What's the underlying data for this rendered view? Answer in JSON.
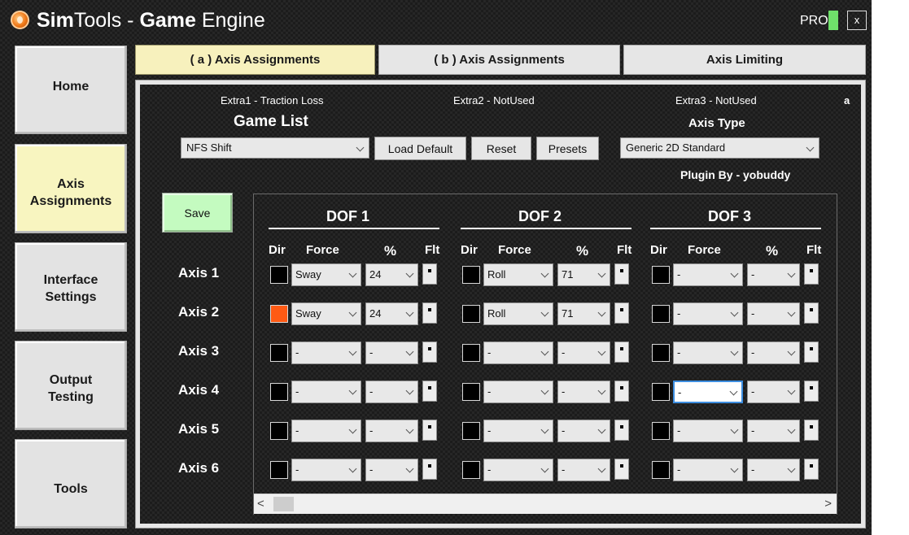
{
  "title": {
    "bold1": "Sim",
    "plain1": "Tools - ",
    "bold2": "Game",
    "plain2": " Engine"
  },
  "pro_label": "PRO",
  "close_glyph": "x",
  "nav": [
    {
      "line1": "Home",
      "line2": ""
    },
    {
      "line1": "Axis",
      "line2": "Assignments"
    },
    {
      "line1": "Interface",
      "line2": "Settings"
    },
    {
      "line1": "Output",
      "line2": "Testing"
    },
    {
      "line1": "Tools",
      "line2": ""
    }
  ],
  "tabs": [
    "( a ) Axis Assignments",
    "( b ) Axis Assignments",
    "Axis Limiting"
  ],
  "extras": [
    "Extra1 - Traction Loss",
    "Extra2 - NotUsed",
    "Extra3 - NotUsed"
  ],
  "corner_letter": "a",
  "game_list": {
    "heading": "Game List",
    "value": "NFS Shift"
  },
  "buttons": {
    "load_default": "Load Default",
    "reset": "Reset",
    "presets": "Presets",
    "save": "Save"
  },
  "axis_type": {
    "heading": "Axis Type",
    "value": "Generic 2D Standard"
  },
  "plugin_by": "Plugin By - yobuddy",
  "dof_titles": [
    "DOF 1",
    "DOF 2",
    "DOF 3"
  ],
  "col_heads": {
    "dir": "Dir",
    "force": "Force",
    "pct": "%",
    "flt": "Flt"
  },
  "axes": [
    {
      "label": "Axis 1",
      "dof": [
        {
          "dir_on": false,
          "force": "Sway",
          "pct": "24"
        },
        {
          "dir_on": false,
          "force": "Roll",
          "pct": "71"
        },
        {
          "dir_on": false,
          "force": "-",
          "pct": "-"
        }
      ]
    },
    {
      "label": "Axis 2",
      "dof": [
        {
          "dir_on": true,
          "force": "Sway",
          "pct": "24"
        },
        {
          "dir_on": false,
          "force": "Roll",
          "pct": "71"
        },
        {
          "dir_on": false,
          "force": "-",
          "pct": "-"
        }
      ]
    },
    {
      "label": "Axis 3",
      "dof": [
        {
          "dir_on": false,
          "force": "-",
          "pct": "-"
        },
        {
          "dir_on": false,
          "force": "-",
          "pct": "-"
        },
        {
          "dir_on": false,
          "force": "-",
          "pct": "-"
        }
      ]
    },
    {
      "label": "Axis 4",
      "dof": [
        {
          "dir_on": false,
          "force": "-",
          "pct": "-"
        },
        {
          "dir_on": false,
          "force": "-",
          "pct": "-"
        },
        {
          "dir_on": false,
          "force": "-",
          "pct": "-",
          "focused": true
        }
      ]
    },
    {
      "label": "Axis 5",
      "dof": [
        {
          "dir_on": false,
          "force": "-",
          "pct": "-"
        },
        {
          "dir_on": false,
          "force": "-",
          "pct": "-"
        },
        {
          "dir_on": false,
          "force": "-",
          "pct": "-"
        }
      ]
    },
    {
      "label": "Axis 6",
      "dof": [
        {
          "dir_on": false,
          "force": "-",
          "pct": "-"
        },
        {
          "dir_on": false,
          "force": "-",
          "pct": "-"
        },
        {
          "dir_on": false,
          "force": "-",
          "pct": "-"
        }
      ]
    }
  ],
  "scroll": {
    "left_glyph": "<",
    "right_glyph": ">"
  },
  "colors": {
    "active_green": "#6fe06a",
    "dir_on": "#ff5a14",
    "active_tab": "#f7f1bd",
    "save_green": "#c4fbc0"
  }
}
